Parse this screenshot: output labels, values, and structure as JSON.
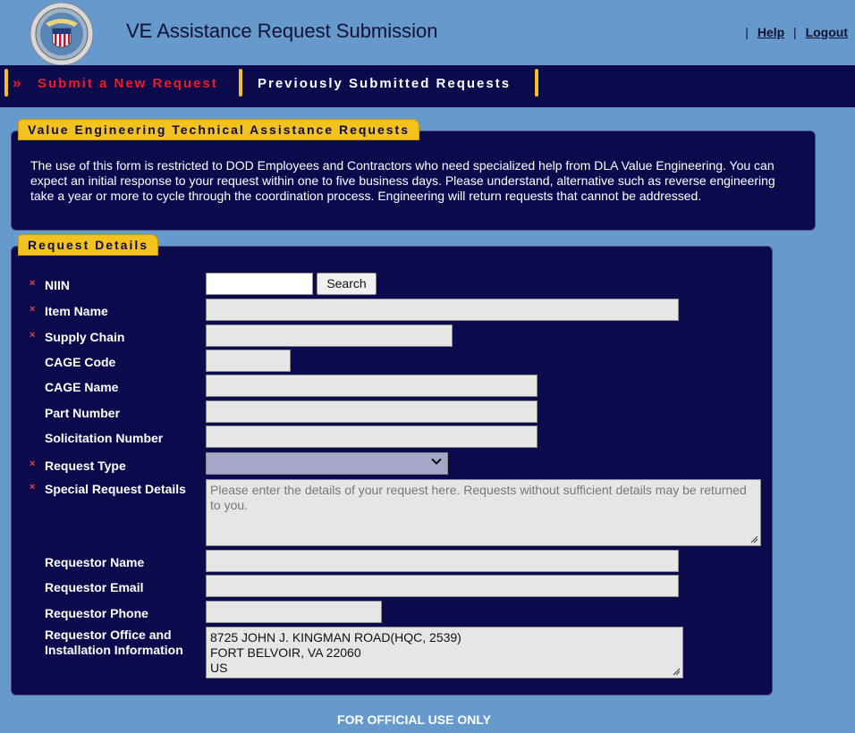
{
  "header": {
    "title": "VE Assistance Request Submission",
    "links": [
      {
        "label": "Help"
      },
      {
        "label": "Logout"
      }
    ],
    "separator": "|"
  },
  "nav": {
    "chevron": "»",
    "items": [
      {
        "label": "Submit a New Request",
        "active": true
      },
      {
        "label": "Previously Submitted Requests",
        "active": false
      }
    ]
  },
  "intro_panel": {
    "title": "Value Engineering Technical Assistance Requests",
    "text": "The use of this form is restricted to DOD Employees and Contractors who need specialized help from DLA Value Engineering. You can expect an initial response to your request within one to five business days. Please understand, alternative such as reverse engineering take a year or more to cycle through the coordination process. Engineering will return requests that cannot be addressed."
  },
  "form": {
    "title": "Request Details",
    "required_marker": "×",
    "search_label": "Search",
    "fields": {
      "niin": {
        "label": "NIIN",
        "value": ""
      },
      "item_name": {
        "label": "Item Name",
        "value": ""
      },
      "supply_chain": {
        "label": "Supply Chain",
        "value": ""
      },
      "cage_code": {
        "label": "CAGE Code",
        "value": ""
      },
      "cage_name": {
        "label": "CAGE Name",
        "value": ""
      },
      "part_number": {
        "label": "Part Number",
        "value": ""
      },
      "solicitation_number": {
        "label": "Solicitation Number",
        "value": ""
      },
      "request_type": {
        "label": "Request Type",
        "value": ""
      },
      "special_request_details": {
        "label": "Special Request Details",
        "placeholder": "Please enter the details of your request here. Requests without sufficient details may be returned to you."
      },
      "requestor_name": {
        "label": "Requestor Name",
        "value": ""
      },
      "requestor_email": {
        "label": "Requestor Email",
        "value": ""
      },
      "requestor_phone": {
        "label": "Requestor Phone",
        "value": ""
      },
      "requestor_office": {
        "label_line1": "Requestor Office and",
        "label_line2": "Installation Information",
        "value": "8725 JOHN J. KINGMAN ROAD(HQC, 2539)\nFORT BELVOIR, VA 22060\nUS"
      }
    }
  },
  "footer": {
    "text": "FOR OFFICIAL USE ONLY"
  },
  "colors": {
    "page_bg": "#6699cc",
    "navy": "#0a0a4d",
    "gold": "#f4c21f",
    "active_red": "#ee1c25"
  },
  "icons": {
    "logo": "dla-seal-logo",
    "chevron": "chevron-down-icon",
    "required": "required-asterisk-icon"
  }
}
